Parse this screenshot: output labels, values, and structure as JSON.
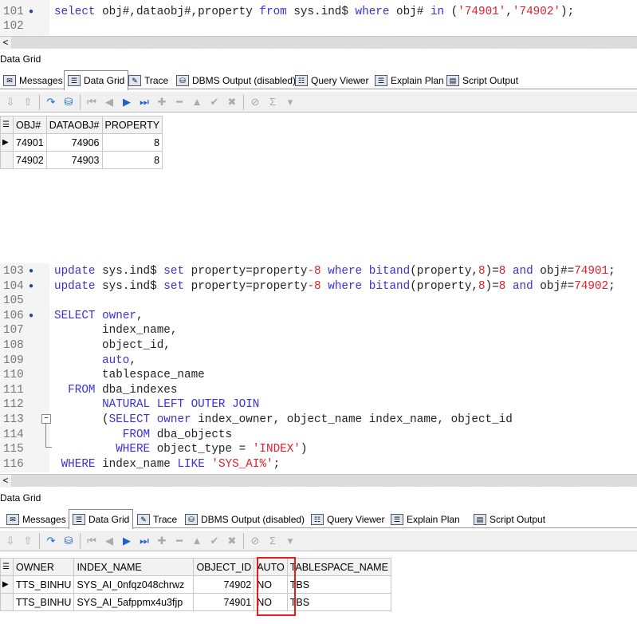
{
  "editor1": {
    "lines": [
      {
        "num": "101",
        "dot": true,
        "tokens": [
          [
            "select",
            "kw"
          ],
          " obj#,dataobj#,property ",
          [
            "from",
            "kw"
          ],
          " sys.ind$ ",
          [
            "where",
            "kw"
          ],
          " obj# ",
          [
            "in",
            "kw"
          ],
          " (",
          [
            "'74901'",
            "str"
          ],
          ",",
          [
            "'74902'",
            "str"
          ],
          ");"
        ]
      },
      {
        "num": "102",
        "dot": false,
        "tokens": []
      }
    ]
  },
  "editor2": {
    "lines": [
      {
        "num": "103",
        "dot": true,
        "tokens": [
          [
            "update",
            "kw"
          ],
          " sys.ind$ ",
          [
            "set",
            "kw"
          ],
          " property=property",
          [
            "-8",
            "str"
          ],
          " ",
          [
            "where",
            "kw"
          ],
          " ",
          [
            "bitand",
            "kw"
          ],
          "(property,",
          [
            "8",
            "str"
          ],
          ")=",
          [
            "8",
            "str"
          ],
          " ",
          [
            "and",
            "kw"
          ],
          " obj#=",
          [
            "74901",
            "str"
          ],
          ";"
        ]
      },
      {
        "num": "104",
        "dot": true,
        "tokens": [
          [
            "update",
            "kw"
          ],
          " sys.ind$ ",
          [
            "set",
            "kw"
          ],
          " property=property",
          [
            "-8",
            "str"
          ],
          " ",
          [
            "where",
            "kw"
          ],
          " ",
          [
            "bitand",
            "kw"
          ],
          "(property,",
          [
            "8",
            "str"
          ],
          ")=",
          [
            "8",
            "str"
          ],
          " ",
          [
            "and",
            "kw"
          ],
          " obj#=",
          [
            "74902",
            "str"
          ],
          ";"
        ]
      },
      {
        "num": "105",
        "dot": false,
        "tokens": []
      },
      {
        "num": "106",
        "dot": true,
        "tokens": [
          [
            "SELECT",
            "kw"
          ],
          " ",
          [
            "owner",
            "kw"
          ],
          ","
        ]
      },
      {
        "num": "107",
        "dot": false,
        "tokens": [
          "       index_name,"
        ]
      },
      {
        "num": "108",
        "dot": false,
        "tokens": [
          "       object_id,"
        ]
      },
      {
        "num": "109",
        "dot": false,
        "tokens": [
          "       ",
          [
            "auto",
            "kw"
          ],
          ","
        ]
      },
      {
        "num": "110",
        "dot": false,
        "tokens": [
          "       tablespace_name"
        ]
      },
      {
        "num": "111",
        "dot": false,
        "tokens": [
          "  ",
          [
            "FROM",
            "kw"
          ],
          " dba_indexes"
        ]
      },
      {
        "num": "112",
        "dot": false,
        "tokens": [
          "       ",
          [
            "NATURAL LEFT OUTER JOIN",
            "kw"
          ]
        ]
      },
      {
        "num": "113",
        "dot": false,
        "tokens": [
          "       (",
          [
            "SELECT",
            "kw"
          ],
          " ",
          [
            "owner",
            "kw"
          ],
          " index_owner, object_name index_name, object_id"
        ]
      },
      {
        "num": "114",
        "dot": false,
        "tokens": [
          "          ",
          [
            "FROM",
            "kw"
          ],
          " dba_objects"
        ]
      },
      {
        "num": "115",
        "dot": false,
        "tokens": [
          "         ",
          [
            "WHERE",
            "kw"
          ],
          " object_type = ",
          [
            "'INDEX'",
            "str"
          ],
          ")"
        ]
      },
      {
        "num": "116",
        "dot": false,
        "tokens": [
          " ",
          [
            "WHERE",
            "kw"
          ],
          " index_name ",
          [
            "LIKE",
            "kw"
          ],
          " ",
          [
            "'SYS_AI%'",
            "str"
          ],
          ";"
        ]
      }
    ]
  },
  "panel_label": "Data Grid",
  "tabs": [
    "Messages",
    "Data Grid",
    "Trace",
    "DBMS Output (disabled)",
    "Query Viewer",
    "Explain Plan",
    "Script Output"
  ],
  "active_tab": "Data Grid",
  "grid1": {
    "columns": [
      "OBJ#",
      "DATAOBJ#",
      "PROPERTY"
    ],
    "rows": [
      [
        "74901",
        "74906",
        "8"
      ],
      [
        "74902",
        "74903",
        "8"
      ]
    ]
  },
  "grid2": {
    "columns": [
      "OWNER",
      "INDEX_NAME",
      "OBJECT_ID",
      "AUTO",
      "TABLESPACE_NAME"
    ],
    "rows": [
      [
        "TTS_BINHU",
        "SYS_AI_0nfqz048chrwz",
        "74902",
        "NO",
        "TBS"
      ],
      [
        "TTS_BINHU",
        "SYS_AI_5afppmx4u3fjp",
        "74901",
        "NO",
        "TBS"
      ]
    ],
    "highlighted_column": "AUTO",
    "highlight_color": "#e02020"
  },
  "colors": {
    "keyword": "#3a32d8",
    "string": "#e0202a"
  }
}
